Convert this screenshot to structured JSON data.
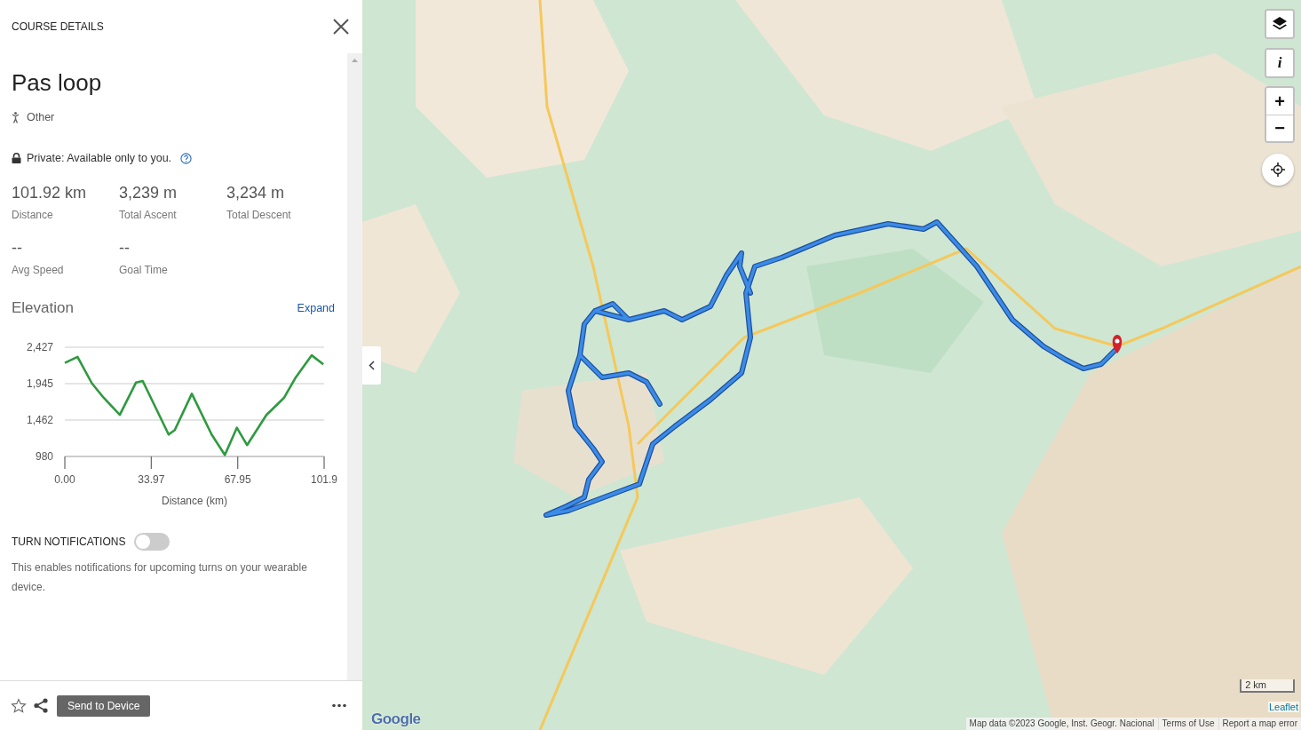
{
  "panel": {
    "header": "COURSE DETAILS",
    "title": "Pas loop",
    "activity": "Other",
    "privacy": "Private: Available only to you.",
    "stats": [
      {
        "value": "101.92 km",
        "label": "Distance"
      },
      {
        "value": "3,239 m",
        "label": "Total Ascent"
      },
      {
        "value": "3,234 m",
        "label": "Total Descent"
      },
      {
        "value": "--",
        "label": "Avg Speed"
      },
      {
        "value": "--",
        "label": "Goal Time"
      }
    ],
    "elevation": {
      "heading": "Elevation",
      "expand_link": "Expand",
      "chart_data": {
        "type": "line",
        "xlabel": "Distance (km)",
        "x": [
          0,
          5.0,
          10.6,
          15.2,
          21.6,
          28.0,
          30.6,
          40.8,
          43.2,
          49.9,
          57.7,
          62.9,
          67.6,
          71.6,
          79.2,
          86.2,
          90.8,
          97.0,
          101.6
        ],
        "series": [
          {
            "color": "#2e9a3f",
            "values": [
              2220,
              2300,
              1950,
              1760,
              1530,
              1960,
              1980,
              1270,
              1330,
              1810,
              1270,
              1000,
              1360,
              1130,
              1530,
              1760,
              2030,
              2320,
              2200
            ]
          }
        ],
        "xlim": [
          0,
          101.9
        ],
        "ylim": [
          980,
          2427
        ],
        "xticks": [
          {
            "value": 0,
            "label": "0.00"
          },
          {
            "value": 33.97,
            "label": "33.97"
          },
          {
            "value": 67.95,
            "label": "67.95"
          },
          {
            "value": 101.9,
            "label": "101.9"
          }
        ],
        "yticks": [
          {
            "value": 980,
            "label": "980"
          },
          {
            "value": 1462,
            "label": "1,462"
          },
          {
            "value": 1945,
            "label": "1,945"
          },
          {
            "value": 2427,
            "label": "2,427"
          }
        ]
      }
    },
    "turn_notifications": {
      "label": "TURN NOTIFICATIONS",
      "on": false,
      "description": "This enables notifications for upcoming turns on your wearable device."
    }
  },
  "footer": {
    "favorite": false,
    "send_button": "Send to Device"
  },
  "map": {
    "info_button": "i",
    "zoom_in": "+",
    "zoom_out": "−",
    "scale": "2 km",
    "leaflet_link": "Leaflet",
    "logo": "Google",
    "attribution": "Map data ©2023 Google, Inst. Geogr. Nacional",
    "terms_link": "Terms of Use",
    "report_link": "Report a map error"
  }
}
